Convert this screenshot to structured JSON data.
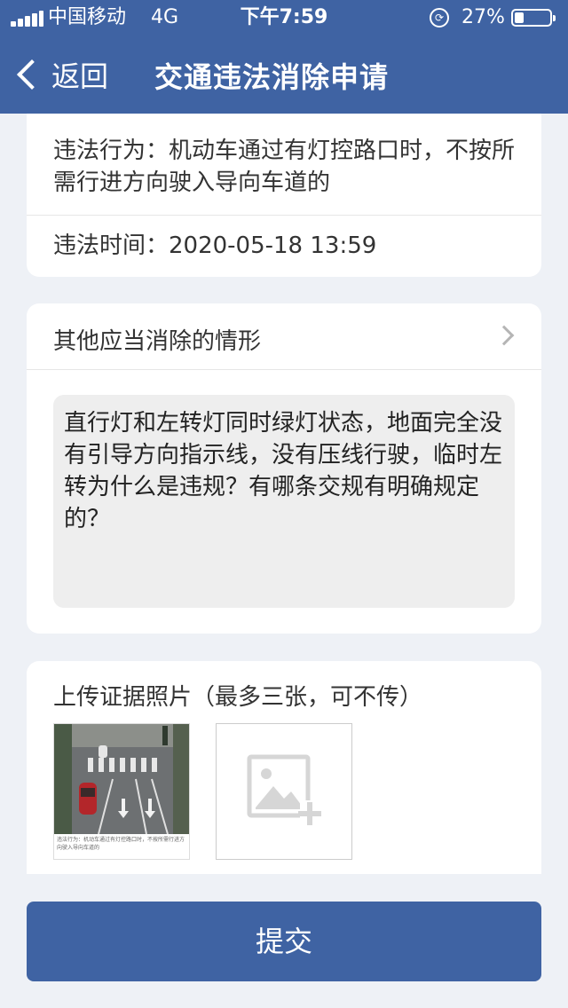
{
  "status_bar": {
    "carrier": "中国移动",
    "network": "4G",
    "time": "下午7:59",
    "battery_text": "27%",
    "battery_level": 0.27
  },
  "nav": {
    "back_label": "返回",
    "title": "交通违法消除申请"
  },
  "violation": {
    "behavior": "违法行为：机动车通过有灯控路口时，不按所需行进方向驶入导向车道的",
    "time": "违法时间：2020-05-18 13:59"
  },
  "other_situation": {
    "label": "其他应当消除的情形",
    "text": "直行灯和左转灯同时绿灯状态，地面完全没有引导方向指示线，没有压线行驶，临时左转为什么是违规？有哪条交规有明确规定的？"
  },
  "upload": {
    "title": "上传证据照片（最多三张，可不传）",
    "photo_caption": "违法行为：机动车通过有灯控路口时，不按所需行进方向驶入导向车道的"
  },
  "submit_label": "提交",
  "colors": {
    "primary": "#3f63a3",
    "background": "#eef1f6",
    "card": "#ffffff",
    "textarea": "#eeeeee"
  }
}
